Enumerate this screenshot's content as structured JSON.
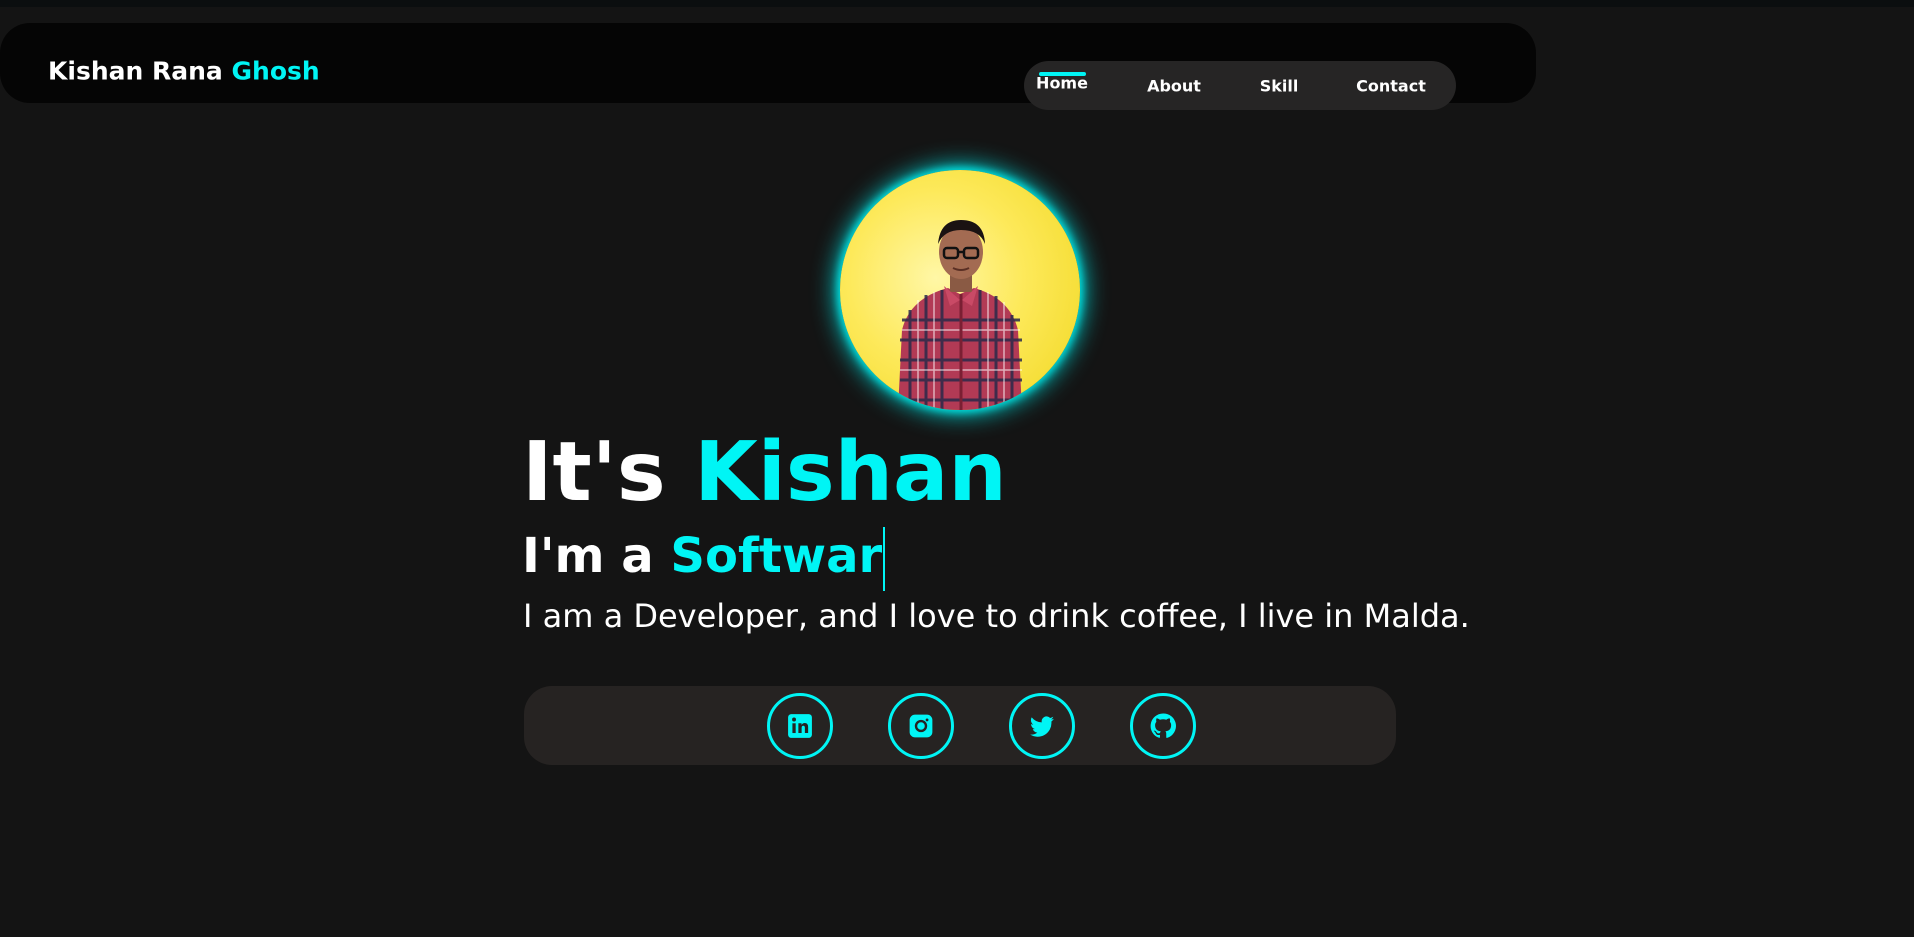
{
  "header": {
    "logo_first": "Kishan Rana",
    "logo_accent": "Ghosh",
    "nav": [
      {
        "label": "Home",
        "active": true
      },
      {
        "label": "About"
      },
      {
        "label": "Skill"
      },
      {
        "label": "Contact"
      }
    ]
  },
  "hero": {
    "heading_prefix": "It's",
    "heading_name": "Kishan",
    "role_prefix": "I'm a",
    "role_typed": "Softwar",
    "description": "I am a Developer, and I love to drink coffee, I live in Malda."
  },
  "social": {
    "icons": [
      "linkedin-icon",
      "instagram-icon",
      "twitter-icon",
      "github-icon"
    ]
  },
  "colors": {
    "background": "#141414",
    "navbar": "#050505",
    "nav_pill": "#262525",
    "accent": "#00f5f5",
    "social_bar": "#262322"
  }
}
